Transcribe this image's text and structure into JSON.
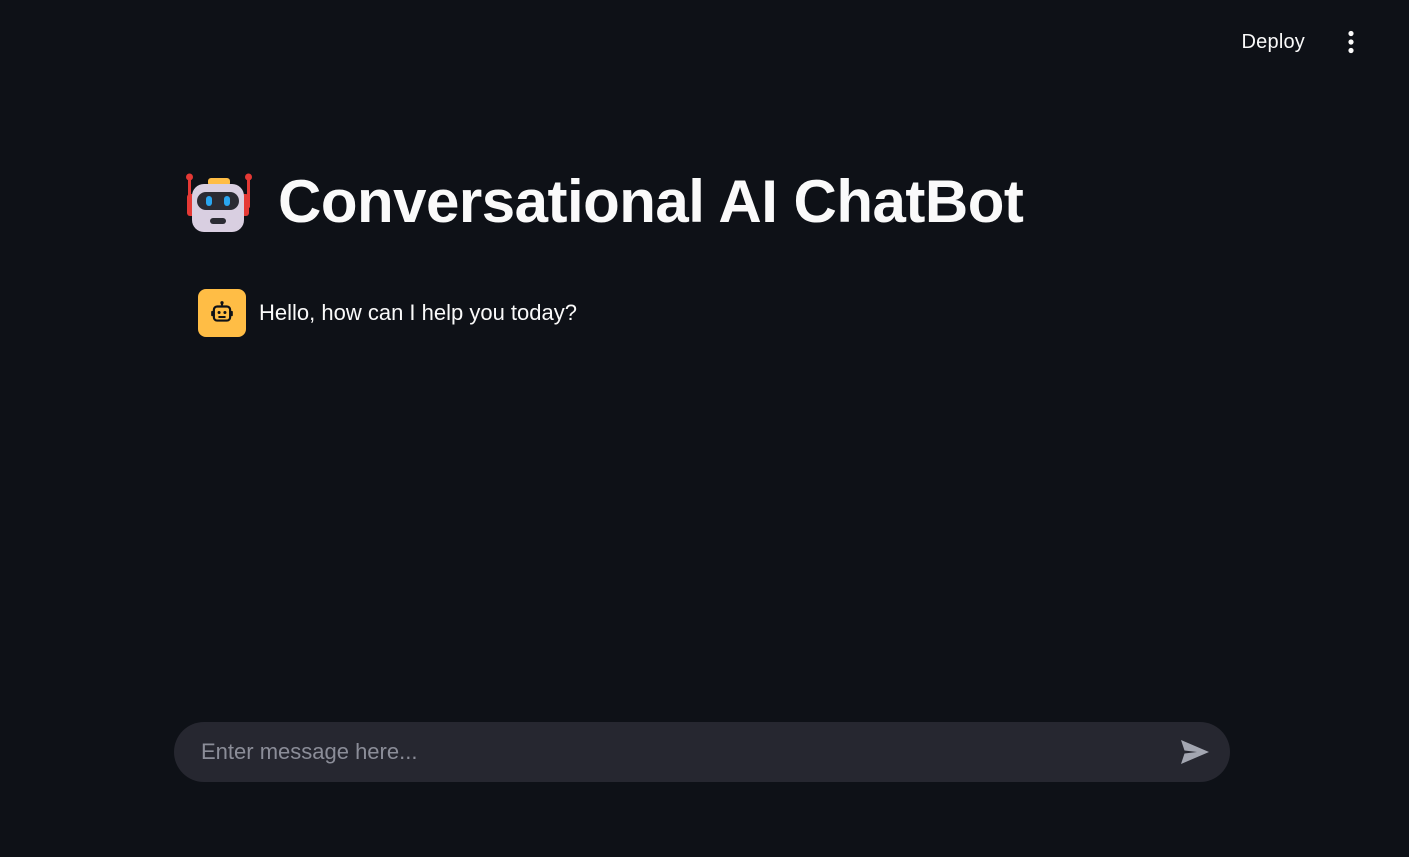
{
  "toolbar": {
    "deploy_label": "Deploy",
    "menu_icon": "vertical-ellipsis-icon"
  },
  "header": {
    "title": "Conversational AI ChatBot",
    "title_icon": "robot-face-icon"
  },
  "chat": {
    "messages": [
      {
        "role": "assistant",
        "avatar_icon": "robot-icon",
        "text": "Hello, how can I help you today?"
      }
    ]
  },
  "input": {
    "value": "",
    "placeholder": "Enter message here...",
    "send_icon": "send-icon"
  },
  "colors": {
    "background": "#0e1117",
    "text": "#fafafa",
    "avatar_bg": "#ffbd45",
    "input_bg": "#262730",
    "placeholder": "#8b8d98"
  }
}
